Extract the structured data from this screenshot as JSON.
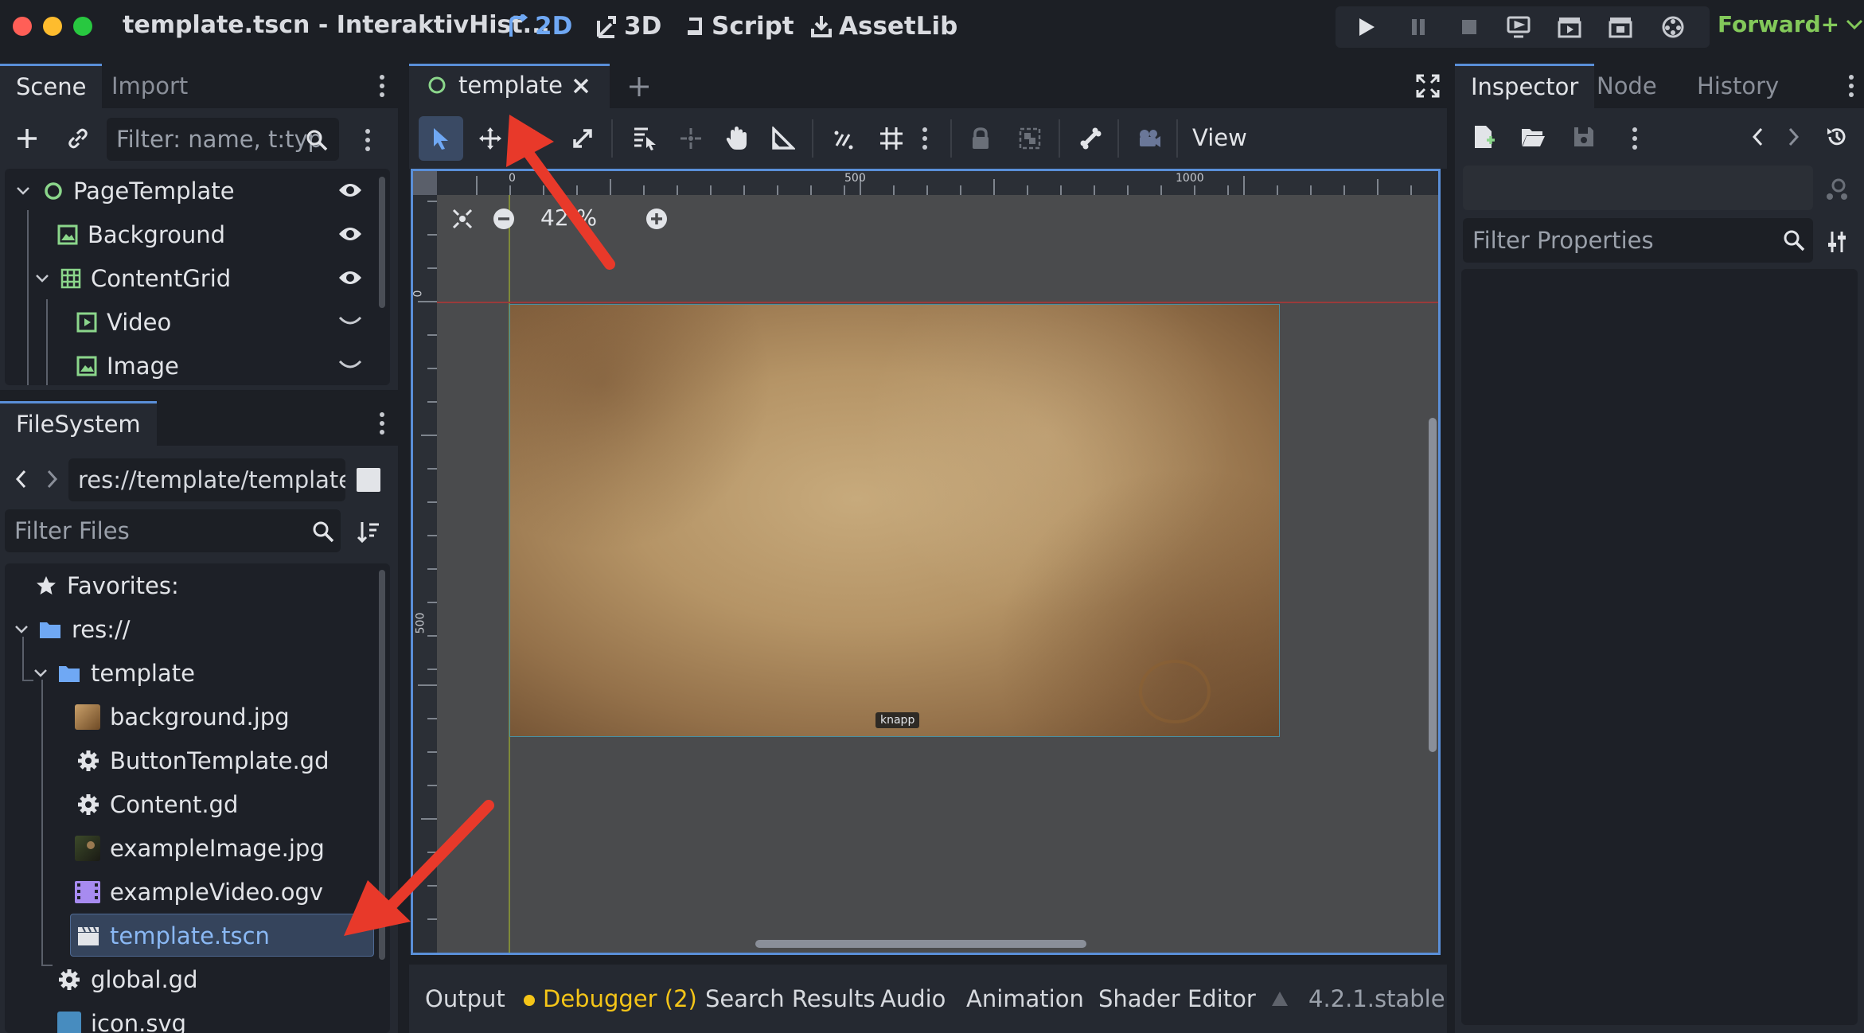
{
  "window": {
    "title": "template.tscn - InteraktivHist...",
    "traffic_colors": [
      "#ff5f57",
      "#febc2e",
      "#28c840"
    ]
  },
  "workspaces": [
    {
      "label": "2D",
      "icon": "2d-icon",
      "active": true
    },
    {
      "label": "3D",
      "icon": "3d-icon",
      "active": false
    },
    {
      "label": "Script",
      "icon": "script-icon",
      "active": false
    },
    {
      "label": "AssetLib",
      "icon": "assetlib-icon",
      "active": false
    }
  ],
  "run_controls": [
    "play-icon",
    "pause-icon",
    "stop-icon",
    "remote-debug-icon",
    "play-scene-icon",
    "play-custom-scene-icon",
    "movie-maker-icon"
  ],
  "renderer": "Forward+",
  "scene_dock": {
    "tabs": [
      "Scene",
      "Import"
    ],
    "filter_placeholder": "Filter: name, t:typ",
    "nodes": [
      {
        "name": "PageTemplate",
        "icon": "control-icon",
        "visible": true,
        "level": 0
      },
      {
        "name": "Background",
        "icon": "texture-rect-icon",
        "visible": true,
        "level": 1
      },
      {
        "name": "ContentGrid",
        "icon": "grid-container-icon",
        "visible": true,
        "level": 1
      },
      {
        "name": "Video",
        "icon": "video-player-icon",
        "visible": false,
        "level": 2
      },
      {
        "name": "Image",
        "icon": "texture-rect-icon",
        "visible": false,
        "level": 2
      }
    ]
  },
  "filesystem": {
    "tab": "FileSystem",
    "path": "res://template/template.",
    "filter_placeholder": "Filter Files",
    "items": [
      {
        "name": "Favorites:",
        "icon": "star-icon"
      },
      {
        "name": "res://",
        "icon": "folder-icon"
      },
      {
        "name": "template",
        "icon": "folder-icon"
      },
      {
        "name": "background.jpg",
        "icon": "image-thumb-icon"
      },
      {
        "name": "ButtonTemplate.gd",
        "icon": "gear-icon"
      },
      {
        "name": "Content.gd",
        "icon": "gear-icon"
      },
      {
        "name": "exampleImage.jpg",
        "icon": "image-thumb-icon"
      },
      {
        "name": "exampleVideo.ogv",
        "icon": "video-file-icon"
      },
      {
        "name": "template.tscn",
        "icon": "scene-file-icon",
        "selected": true
      },
      {
        "name": "global.gd",
        "icon": "gear-icon"
      },
      {
        "name": "icon.svg",
        "icon": "image-thumb-icon"
      }
    ]
  },
  "editor": {
    "scene_tab": "template",
    "zoom": "42 %",
    "view_menu": "View",
    "ruler_h": [
      "0",
      "500",
      "1000"
    ],
    "ruler_v": [
      "0",
      "500"
    ],
    "canvas_label": "knapp"
  },
  "bottom_panel": {
    "tabs": [
      "Output",
      "Debugger (2)",
      "Search Results",
      "Audio",
      "Animation",
      "Shader Editor"
    ],
    "version": "4.2.1.stable",
    "debugger_dot_color": "#f5c518"
  },
  "inspector": {
    "tabs": [
      "Inspector",
      "Node",
      "History"
    ],
    "filter_placeholder": "Filter Properties"
  },
  "colors": {
    "accent": "#5a8fd8",
    "annotation_arrow": "#e8392a",
    "node_green": "#8bd68b"
  }
}
